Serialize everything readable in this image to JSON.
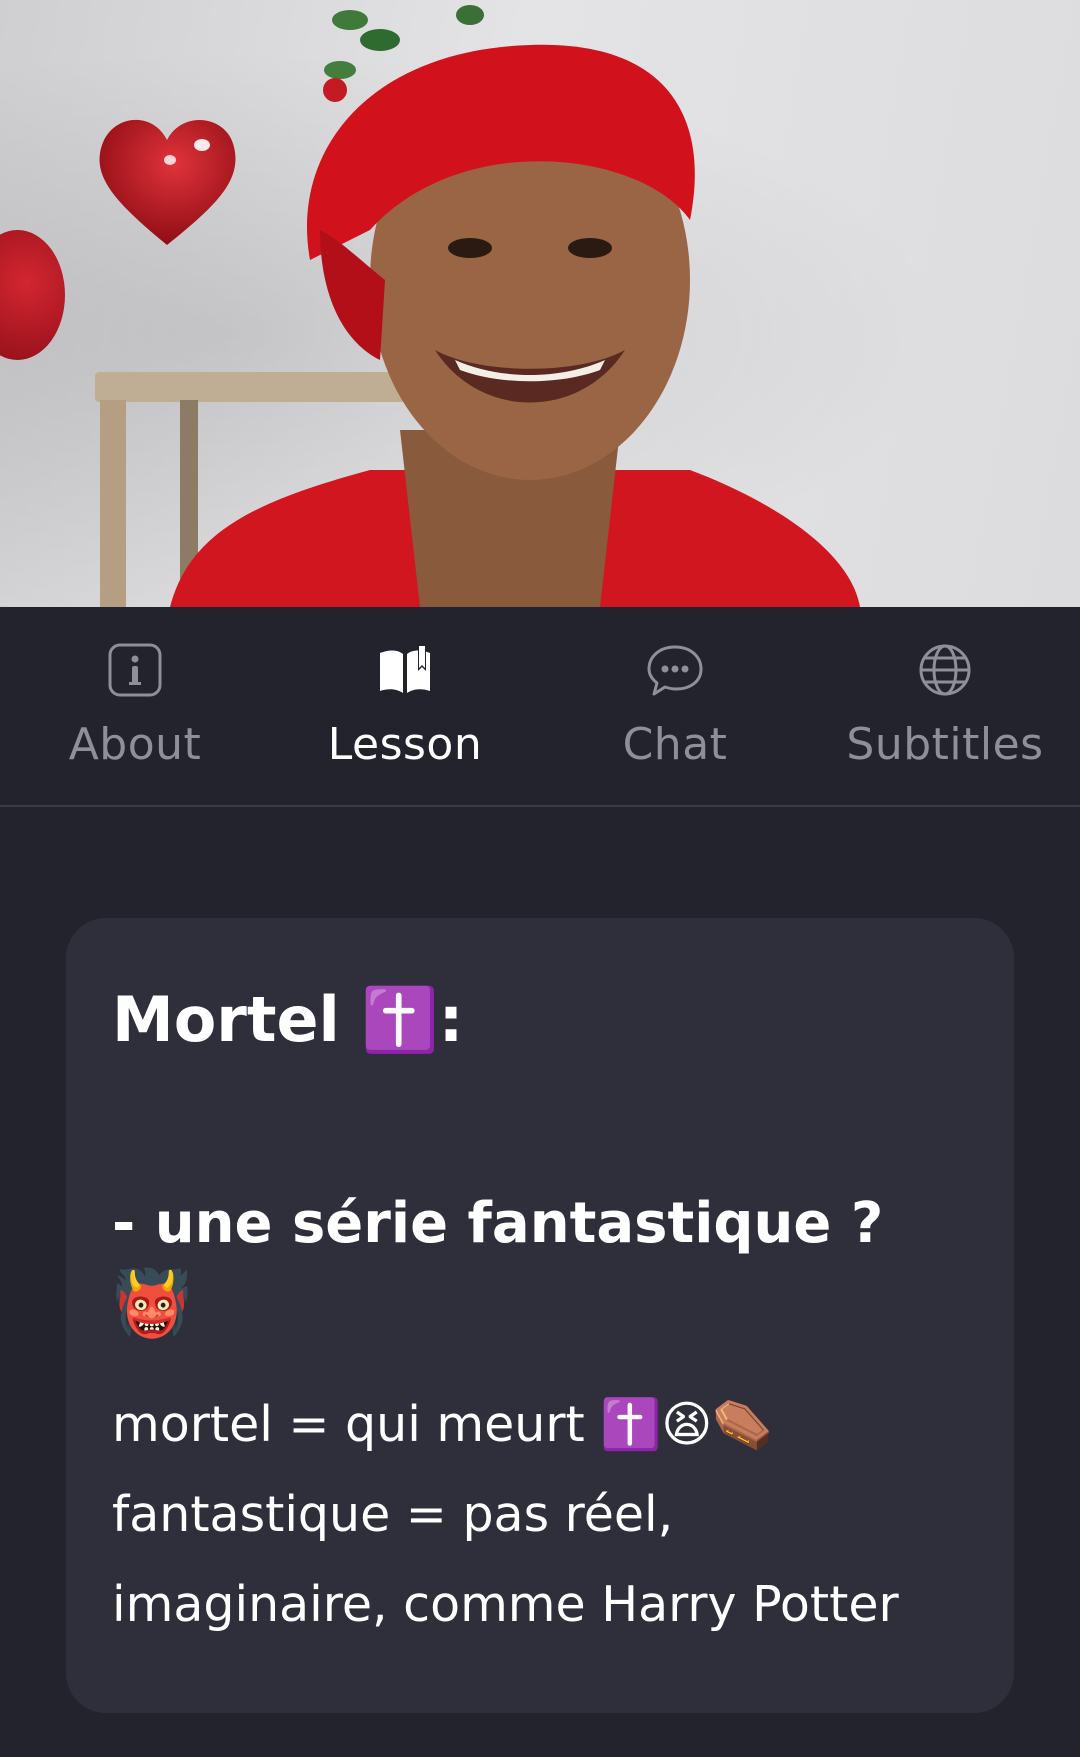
{
  "tabs": [
    {
      "label": "About",
      "icon": "info-icon",
      "active": false
    },
    {
      "label": "Lesson",
      "icon": "book-icon",
      "active": true
    },
    {
      "label": "Chat",
      "icon": "chat-bubble-icon",
      "active": false
    },
    {
      "label": "Subtitles",
      "icon": "globe-icon",
      "active": false
    }
  ],
  "lesson": {
    "title": "Mortel ✝️:",
    "subtitle": "- une série fantastique ?",
    "emoji_line": "👹",
    "lines": [
      "mortel = qui meurt ✝️😫⚰️",
      "fantastique = pas réel,",
      "imaginaire, comme Harry Potter"
    ]
  },
  "colors": {
    "background": "#22232d",
    "card": "#2e2f3b",
    "tab_inactive": "#8e8f99",
    "tab_active": "#ffffff",
    "beret": "#d1121c"
  }
}
